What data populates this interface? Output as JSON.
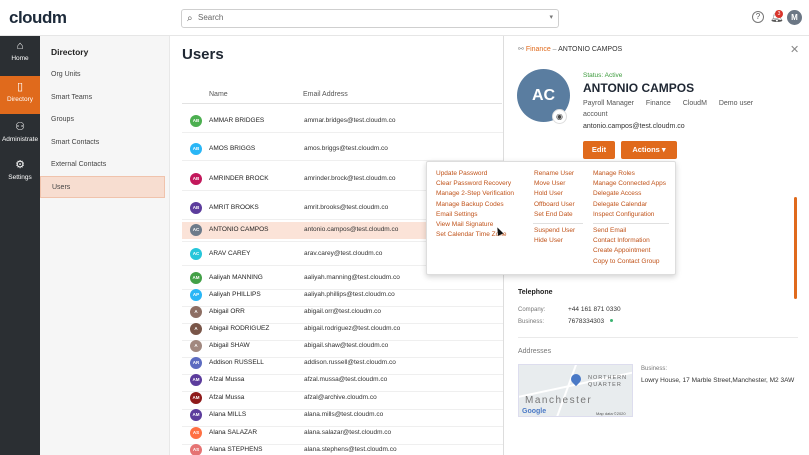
{
  "app": {
    "logo": "cloudm",
    "search_placeholder": "Search",
    "notification_count": "3",
    "user_initial": "M"
  },
  "rail": [
    {
      "label": "Home",
      "icon": "home-icon"
    },
    {
      "label": "Directory",
      "icon": "directory-icon"
    },
    {
      "label": "Administrate",
      "icon": "administrate-icon"
    },
    {
      "label": "Settings",
      "icon": "settings-icon"
    }
  ],
  "directory": {
    "title": "Directory",
    "items": [
      "Org Units",
      "Smart Teams",
      "Groups",
      "Smart Contacts",
      "External Contacts",
      "Users"
    ]
  },
  "users": {
    "title": "Users",
    "columns": [
      "Name",
      "Email Address"
    ],
    "rows": [
      {
        "initials": "AB",
        "name": "AMMAR BRIDGES",
        "email": "ammar.bridges@test.cloudm.co",
        "color": "#4caf50"
      },
      {
        "initials": "AB",
        "name": "AMOS BRIGGS",
        "email": "amos.briggs@test.cloudm.co",
        "color": "#29b6f6"
      },
      {
        "initials": "AB",
        "name": "AMRINDER BROCK",
        "email": "amrinder.brock@test.cloudm.co",
        "color": "#c2185b"
      },
      {
        "initials": "AB",
        "name": "AMRIT BROOKS",
        "email": "amrit.brooks@test.cloudm.co",
        "color": "#5c3c9c"
      },
      {
        "initials": "AC",
        "name": "ANTONIO CAMPOS",
        "email": "antonio.campos@test.cloudm.co",
        "color": "#6d7b8a"
      },
      {
        "initials": "AC",
        "name": "ARAV CAREY",
        "email": "arav.carey@test.cloudm.co",
        "color": "#26c6da"
      },
      {
        "initials": "AM",
        "name": "Aaliyah MANNING",
        "email": "aaliyah.manning@test.cloudm.co",
        "color": "#43a047"
      },
      {
        "initials": "AP",
        "name": "Aaliyah PHILLIPS",
        "email": "aaliyah.phillips@test.cloudm.co",
        "color": "#29b6f6"
      },
      {
        "initials": "A",
        "name": "Abigail ORR",
        "email": "abigail.orr@test.cloudm.co",
        "color": "#8d6e63"
      },
      {
        "initials": "A",
        "name": "Abigail RODRIGUEZ",
        "email": "abigail.rodriguez@test.cloudm.co",
        "color": "#795548"
      },
      {
        "initials": "A",
        "name": "Abigail SHAW",
        "email": "abigail.shaw@test.cloudm.co",
        "color": "#a1887f"
      },
      {
        "initials": "AR",
        "name": "Addison RUSSELL",
        "email": "addison.russell@test.cloudm.co",
        "color": "#5c6bc0"
      },
      {
        "initials": "AM",
        "name": "Afzal Mussa",
        "email": "afzal.mussa@test.cloudm.co",
        "color": "#5c3c9c"
      },
      {
        "initials": "AM",
        "name": "Afzal Mussa",
        "email": "afzal@archive.cloudm.co",
        "color": "#8e1a1a"
      },
      {
        "initials": "AM",
        "name": "Alana MILLS",
        "email": "alana.mills@test.cloudm.co",
        "color": "#5c3c9c"
      },
      {
        "initials": "AS",
        "name": "Alana SALAZAR",
        "email": "alana.salazar@test.cloudm.co",
        "color": "#ff7043"
      },
      {
        "initials": "AS",
        "name": "Alana STEPHENS",
        "email": "alana.stephens@test.cloudm.co",
        "color": "#e57373"
      }
    ]
  },
  "panel": {
    "breadcrumb": {
      "link": "Finance",
      "separator": "–",
      "current": "ANTONIO CAMPOS"
    },
    "avatar_initials": "AC",
    "status": "Status: Active",
    "name": "ANTONIO CAMPOS",
    "meta": [
      "Payroll Manager",
      "Finance",
      "CloudM",
      "Demo user account"
    ],
    "email": "antonio.campos@test.cloudm.co",
    "edit_label": "Edit",
    "actions_label": "Actions ▾",
    "telephone": {
      "title": "Telephone",
      "company_label": "Company:",
      "company_value": "+44 161 871 0330",
      "business_label": "Business:",
      "business_value": "7678334303"
    },
    "addresses": {
      "title": "Addresses",
      "business_label": "Business:",
      "business_value": "Lowry House, 17 Marble Street,Manchester, M2 3AW",
      "map_area": "NORTHERN QUARTER",
      "map_city": "Manchester",
      "map_brand": "Google",
      "map_credit": "Map data ©2020"
    }
  },
  "actions_menu": {
    "col1": [
      "Update Password",
      "Clear Password Recovery",
      "Manage 2-Step Verification",
      "Manage Backup Codes",
      "Email Settings",
      "View Mail Signature",
      "Set Calendar Time Zone"
    ],
    "col2a": [
      "Rename User",
      "Move User",
      "Hold User",
      "Offboard User",
      "Set End Date"
    ],
    "col2b": [
      "Suspend User",
      "Hide User"
    ],
    "col3a": [
      "Manage Roles",
      "Manage Connected Apps",
      "Delegate Access",
      "Delegate Calendar",
      "Inspect Configuration"
    ],
    "col3b": [
      "Send Email",
      "Contact Information",
      "Create Appointment",
      "Copy to Contact Group"
    ]
  }
}
